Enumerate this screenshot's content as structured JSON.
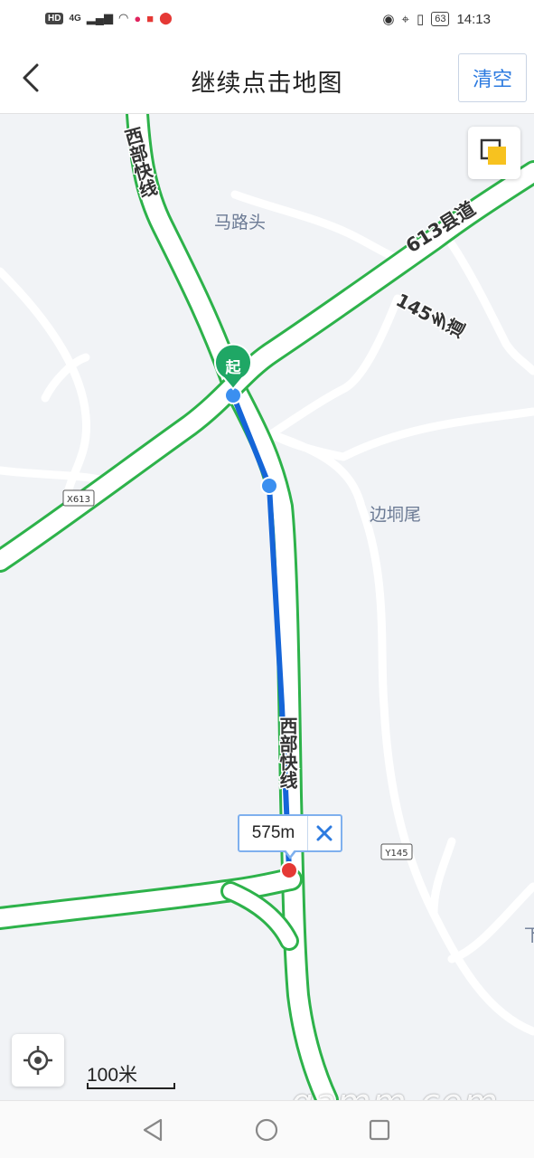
{
  "status_bar": {
    "left_badges": [
      "HD",
      "4G"
    ],
    "time": "14:13",
    "battery": "63"
  },
  "header": {
    "title": "继续点击地图",
    "clear_label": "清空"
  },
  "map": {
    "labels": {
      "west_line_top": "西部快线",
      "west_line_mid": "西部快线",
      "county_road": "613县道",
      "township_road": "145乡道",
      "village_malutou": "马路头",
      "village_biantongwei": "边垌尾",
      "shield_x613": "X613",
      "shield_y145": "Y145",
      "edge_partial": "下"
    },
    "start_marker_label": "起",
    "distance": "575m",
    "scale_label": "100米"
  },
  "colors": {
    "route": "#1565d8",
    "road_outline": "#2db24a",
    "start_marker": "#1fa765",
    "end_marker": "#e53935",
    "accent": "#2d7be0"
  },
  "watermark": "gamm.com"
}
